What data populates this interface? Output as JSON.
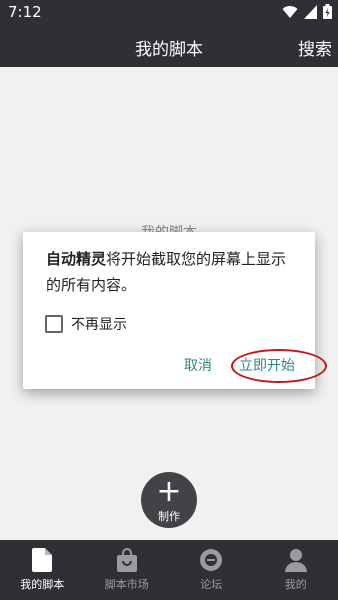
{
  "status": {
    "time": "7:12"
  },
  "appbar": {
    "title": "我的脚本",
    "search_label": "搜索"
  },
  "content": {
    "hidden_text": "我的脚本"
  },
  "dialog": {
    "message_bold": "自动精灵",
    "message_rest": "将开始截取您的屏幕上显示的所有内容。",
    "checkbox_label": "不再显示",
    "cancel_label": "取消",
    "start_label": "立即开始",
    "highlight_color": "#c8161d",
    "accent_color": "#2a8a7a"
  },
  "fab": {
    "label": "制作"
  },
  "bottom_nav": {
    "items": [
      {
        "label": "我的脚本",
        "icon": "document-icon"
      },
      {
        "label": "脚本市场",
        "icon": "shopping-bag-icon"
      },
      {
        "label": "论坛",
        "icon": "forum-icon"
      },
      {
        "label": "我的",
        "icon": "person-icon"
      }
    ]
  }
}
